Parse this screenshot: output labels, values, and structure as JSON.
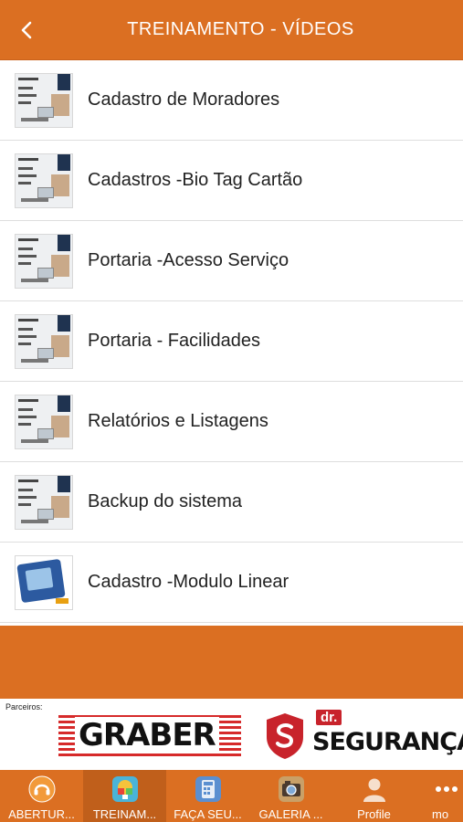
{
  "header": {
    "title": "TREINAMENTO - VÍDEOS",
    "back_icon": "chevron-left-icon"
  },
  "videos": [
    {
      "label": "Cadastro de Moradores",
      "thumb": "video-thumbnail-icon"
    },
    {
      "label": "Cadastros -Bio Tag Cartão",
      "thumb": "video-thumbnail-icon"
    },
    {
      "label": "Portaria -Acesso Serviço",
      "thumb": "video-thumbnail-icon"
    },
    {
      "label": "Portaria - Facilidades",
      "thumb": "video-thumbnail-icon"
    },
    {
      "label": "Relatórios e Listagens",
      "thumb": "video-thumbnail-icon"
    },
    {
      "label": "Backup do sistema",
      "thumb": "video-thumbnail-icon"
    },
    {
      "label": "Cadastro -Modulo Linear",
      "thumb": "modulo-linear-thumbnail-icon"
    }
  ],
  "partners": {
    "label": "Parceiros:",
    "graber": "GRABER",
    "drseg_prefix": "dr.",
    "drseg": "SEGURANÇA"
  },
  "tabbar": {
    "tabs": [
      {
        "label": "ABERTUR...",
        "icon": "headset-icon",
        "active": false
      },
      {
        "label": "TREINAM...",
        "icon": "training-icon",
        "active": true
      },
      {
        "label": "FAÇA SEU...",
        "icon": "calculator-icon",
        "active": false
      },
      {
        "label": "GALERIA ...",
        "icon": "camera-gallery-icon",
        "active": false
      },
      {
        "label": "Profile",
        "icon": "user-icon",
        "active": false
      },
      {
        "label": "mo",
        "icon": "more-dots-icon",
        "active": false
      }
    ]
  },
  "colors": {
    "primary": "#db6f22",
    "active_tab": "#c05f1b",
    "text": "#222222"
  }
}
